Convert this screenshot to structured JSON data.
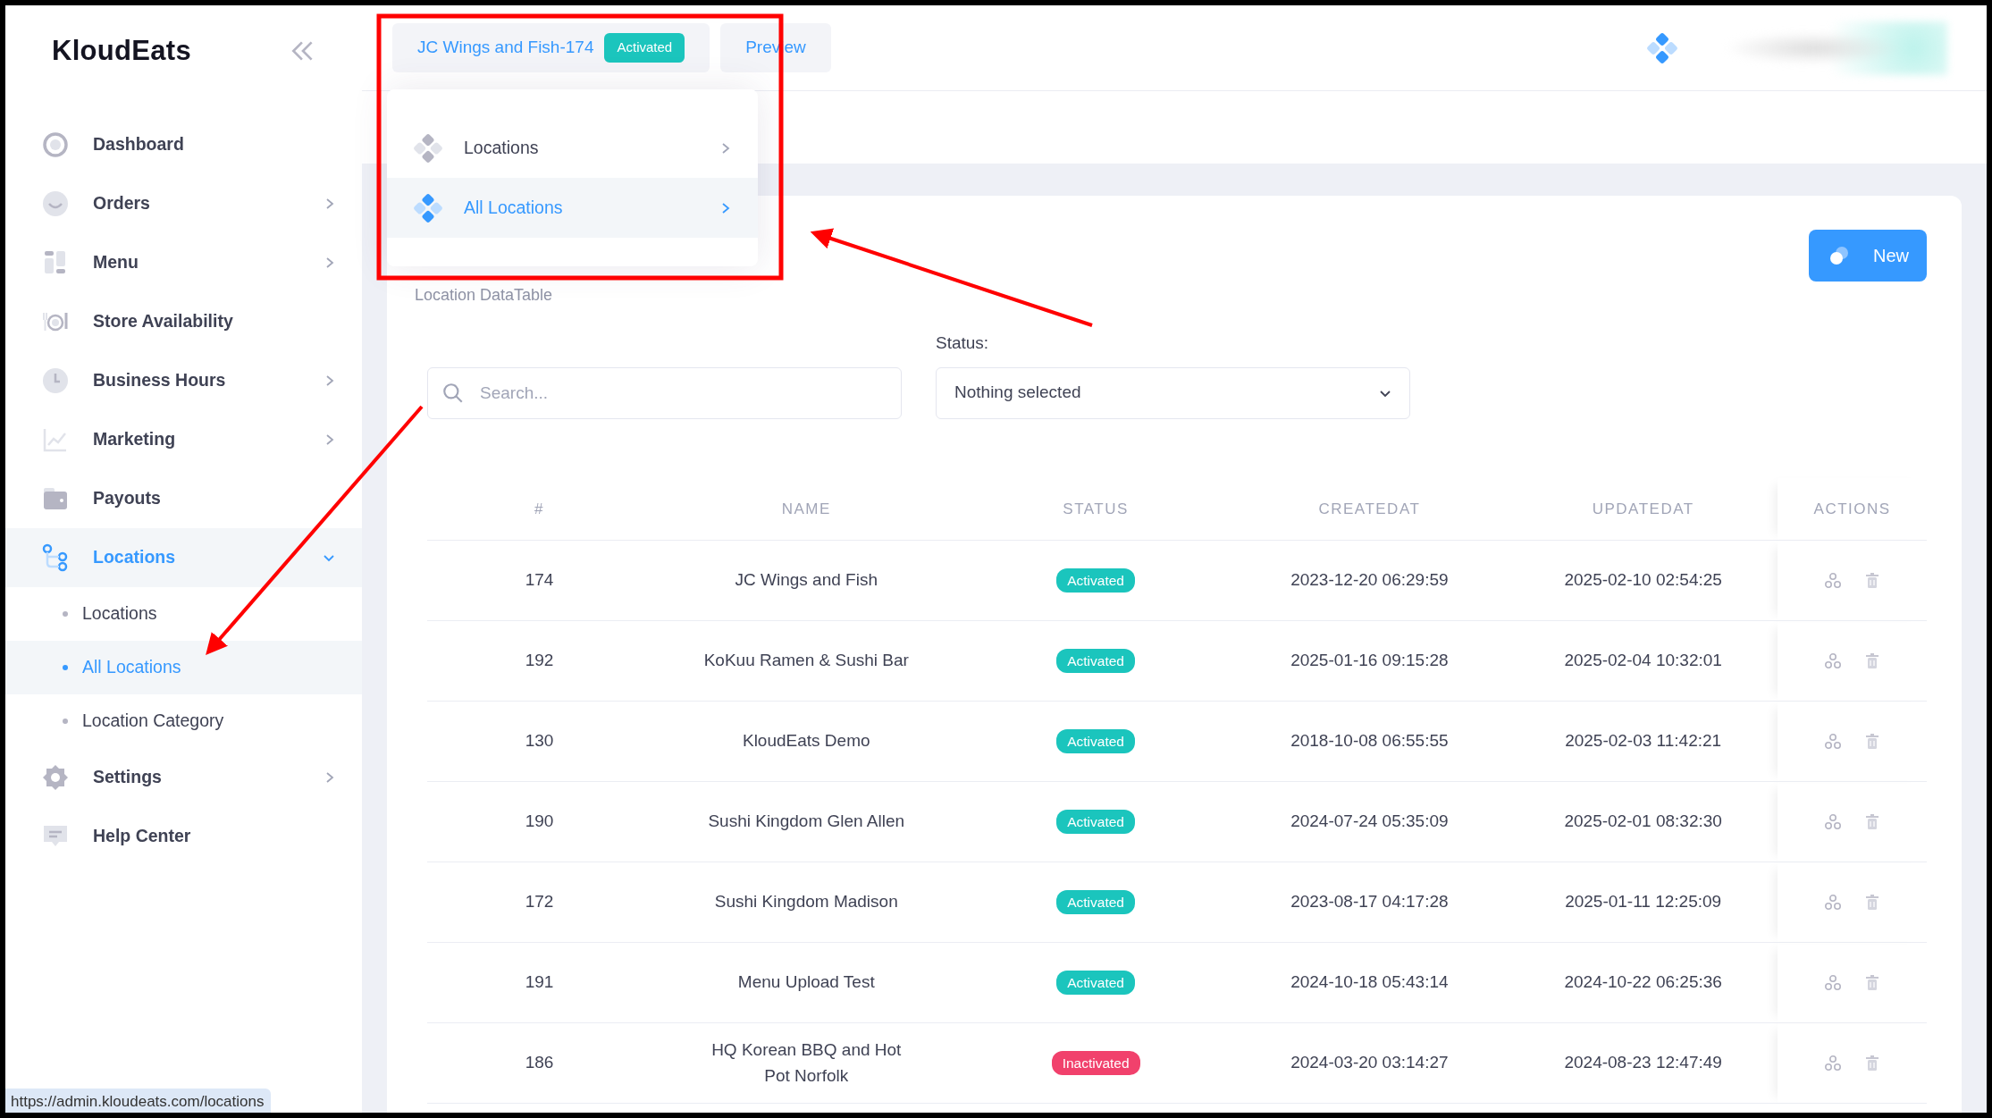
{
  "sidebar": {
    "logo": "KloudEats",
    "items": [
      {
        "label": "Dashboard",
        "selected": false
      },
      {
        "label": "Orders",
        "selected": false,
        "expanded": false
      },
      {
        "label": "Menu",
        "selected": false,
        "expanded": false
      },
      {
        "label": "Store Availability",
        "selected": false
      },
      {
        "label": "Business Hours",
        "selected": false,
        "expanded": false
      },
      {
        "label": "Marketing",
        "selected": false,
        "expanded": false
      },
      {
        "label": "Payouts",
        "selected": false
      },
      {
        "label": "Locations",
        "selected": true,
        "expanded": true,
        "children": [
          {
            "label": "Locations",
            "selected": false
          },
          {
            "label": "All Locations",
            "selected": true
          },
          {
            "label": "Location Category",
            "selected": false
          }
        ]
      },
      {
        "label": "Settings",
        "selected": false,
        "expanded": false
      },
      {
        "label": "Help Center",
        "selected": false
      }
    ]
  },
  "header": {
    "tabs": [
      {
        "label": "JC Wings and Fish-174",
        "badge": "Activated"
      },
      {
        "label": "Preview"
      }
    ]
  },
  "dropdown": {
    "items": [
      {
        "label": "Locations",
        "selected": false
      },
      {
        "label": "All Locations",
        "selected": true
      }
    ]
  },
  "page_title": "Location DataTable",
  "new_button": "New",
  "search": {
    "placeholder": "Search..."
  },
  "status_filter": {
    "label": "Status:",
    "value": "Nothing selected"
  },
  "table": {
    "columns": [
      "#",
      "NAME",
      "STATUS",
      "CREATEDAT",
      "UPDATEDAT",
      "ACTIONS"
    ],
    "rows": [
      {
        "id": "174",
        "name": "JC Wings and Fish",
        "status": "Activated",
        "active": true,
        "created": "2023-12-20 06:29:59",
        "updated": "2025-02-10 02:54:25"
      },
      {
        "id": "192",
        "name": "KoKuu Ramen & Sushi Bar",
        "status": "Activated",
        "active": true,
        "created": "2025-01-16 09:15:28",
        "updated": "2025-02-04 10:32:01"
      },
      {
        "id": "130",
        "name": "KloudEats Demo",
        "status": "Activated",
        "active": true,
        "created": "2018-10-08 06:55:55",
        "updated": "2025-02-03 11:42:21"
      },
      {
        "id": "190",
        "name": "Sushi Kingdom Glen Allen",
        "status": "Activated",
        "active": true,
        "created": "2024-07-24 05:35:09",
        "updated": "2025-02-01 08:32:30"
      },
      {
        "id": "172",
        "name": "Sushi Kingdom Madison",
        "status": "Activated",
        "active": true,
        "created": "2023-08-17 04:17:28",
        "updated": "2025-01-11 12:25:09"
      },
      {
        "id": "191",
        "name": "Menu Upload Test",
        "status": "Activated",
        "active": true,
        "created": "2024-10-18 05:43:14",
        "updated": "2024-10-22 06:25:36"
      },
      {
        "id": "186",
        "name": "HQ Korean BBQ and Hot Pot Norfolk",
        "status": "Inactivated",
        "active": false,
        "created": "2024-03-20 03:14:27",
        "updated": "2024-08-23 12:47:49"
      }
    ]
  },
  "status_bar": "https://admin.kloudeats.com/locations"
}
